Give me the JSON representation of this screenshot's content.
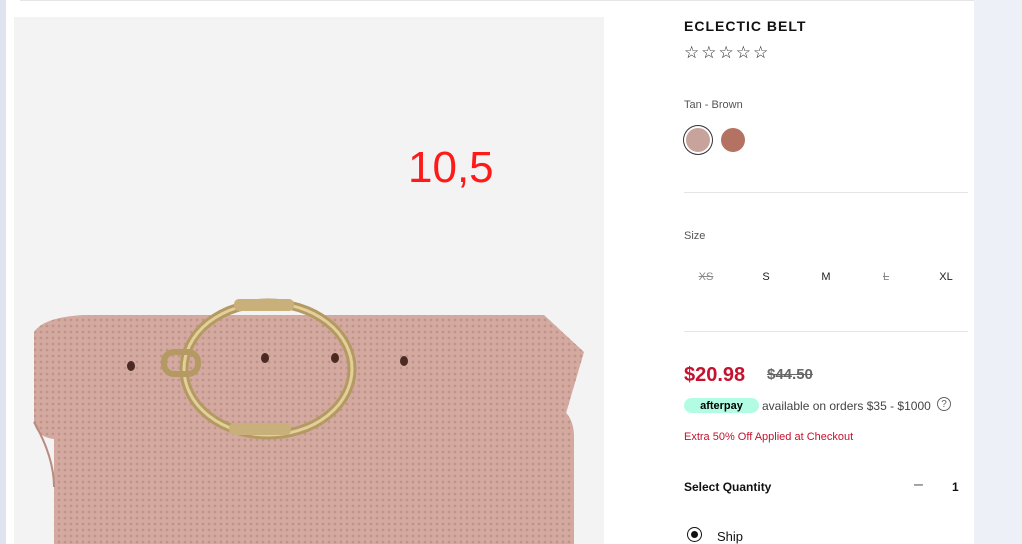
{
  "annotation": "10,5",
  "product": {
    "title": "ECLECTIC BELT",
    "stars": [
      "☆",
      "☆",
      "☆",
      "☆",
      "☆"
    ],
    "color_label": "Tan - Brown",
    "swatches": [
      {
        "name": "Tan - Brown",
        "color": "#c8a39c",
        "selected": true
      },
      {
        "name": "Brown",
        "color": "#b47262",
        "selected": false
      }
    ]
  },
  "size": {
    "label": "Size",
    "options": [
      {
        "label": "XS",
        "available": false
      },
      {
        "label": "S",
        "available": true
      },
      {
        "label": "M",
        "available": true
      },
      {
        "label": "L",
        "available": false
      },
      {
        "label": "XL",
        "available": true
      }
    ]
  },
  "pricing": {
    "sale": "$20.98",
    "original": "$44.50",
    "afterpay_badge": "afterpay",
    "afterpay_text": "available on orders $35 - $1000",
    "help_glyph": "?",
    "promo": "Extra 50% Off Applied at Checkout"
  },
  "quantity": {
    "label": "Select Quantity",
    "minus_glyph": "–",
    "value": "1"
  },
  "fulfillment": {
    "option": "Ship",
    "selected": true
  },
  "colors": {
    "sale_red": "#c4122f",
    "afterpay_mint": "#b2fce4",
    "annotation_red": "#ff1a1a"
  }
}
